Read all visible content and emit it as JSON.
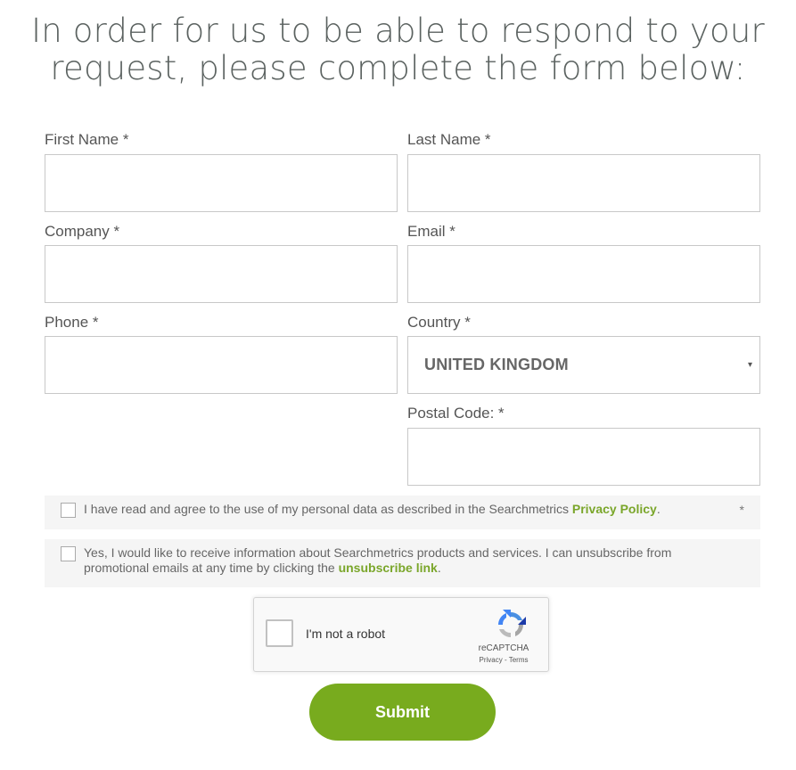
{
  "heading": {
    "line1": "In order for us to be able to respond to your",
    "line2": "request, please complete the form below:"
  },
  "fields": {
    "first_name": {
      "label": "First Name *",
      "value": ""
    },
    "last_name": {
      "label": "Last Name *",
      "value": ""
    },
    "company": {
      "label": "Company *",
      "value": ""
    },
    "email": {
      "label": "Email *",
      "value": ""
    },
    "phone": {
      "label": "Phone *",
      "value": ""
    },
    "country": {
      "label": "Country *",
      "value": "UNITED KINGDOM",
      "caret": "▾"
    },
    "postal_code": {
      "label": "Postal Code: *",
      "value": ""
    }
  },
  "consents": {
    "privacy": {
      "text_before": "I have read and agree to the use of my personal data as described in the Searchmetrics ",
      "link": "Privacy Policy",
      "text_after": ".",
      "required": "*",
      "checked": false
    },
    "marketing": {
      "text_before": "Yes, I would like to receive information about Searchmetrics products and services. I can unsubscribe from promotional emails at any time by clicking the ",
      "link": "unsubscribe link",
      "text_after": ".",
      "checked": false
    }
  },
  "recaptcha": {
    "label": "I'm not a robot",
    "brand": "reCAPTCHA",
    "links": "Privacy - Terms",
    "icon": "recaptcha-logo-icon"
  },
  "submit": {
    "label": "Submit"
  },
  "colors": {
    "accent": "#78ab1e",
    "link": "#7aa62a",
    "border": "#c8c8c8",
    "consent_bg": "#f5f5f5"
  }
}
